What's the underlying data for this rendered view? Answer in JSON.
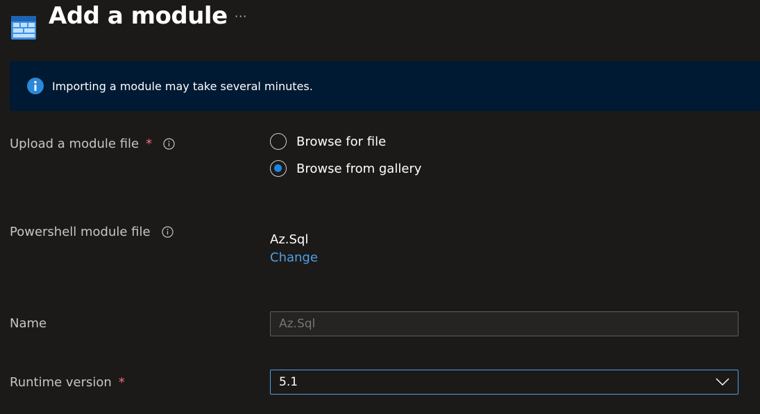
{
  "header": {
    "title": "Add a module",
    "more_label": "···",
    "icon": "module-grid-icon"
  },
  "banner": {
    "icon": "info-icon",
    "text": "Importing a module may take several minutes."
  },
  "form": {
    "upload": {
      "label": "Upload a module file",
      "required": "*",
      "options": [
        {
          "label": "Browse for file",
          "checked": false
        },
        {
          "label": "Browse from gallery",
          "checked": true
        }
      ]
    },
    "module_file": {
      "label": "Powershell module file",
      "value": "Az.Sql",
      "change_label": "Change"
    },
    "name": {
      "label": "Name",
      "placeholder": "Az.Sql"
    },
    "runtime": {
      "label": "Runtime version",
      "required": "*",
      "value": "5.1"
    }
  },
  "colors": {
    "background": "#1b1a19",
    "banner": "#001a33",
    "accent": "#1a86e6",
    "link": "#4f9fe6",
    "required": "#f1707b"
  }
}
